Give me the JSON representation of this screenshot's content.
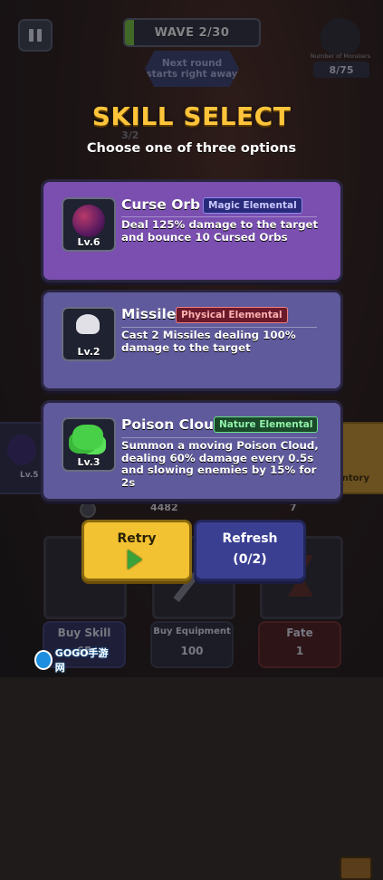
{
  "hud": {
    "wave_text": "WAVE 2/30",
    "wave_progress": 0.07,
    "next_round_text": "Next round starts right away",
    "monsters_label": "Number of Monsters",
    "monsters_count": "8/75",
    "bg_counter": "3/2"
  },
  "dialog": {
    "title": "SKILL SELECT",
    "subtitle": "Choose one of three options"
  },
  "skills": [
    {
      "name": "Curse Orb",
      "tag": "Magic Elemental",
      "level": "Lv.6",
      "description": "Deal 125% damage to the target and bounce 10 Cursed Orbs",
      "icon": "curse-orb-icon",
      "card_color": "#7a4fb0",
      "tag_color": "#5a5ae0"
    },
    {
      "name": "Missile",
      "tag": "Physical Elemental",
      "level": "Lv.2",
      "description": "Cast 2 Missiles dealing 100% damage to the target",
      "icon": "missile-icon",
      "card_color": "#5f5a9c",
      "tag_color": "#e05050"
    },
    {
      "name": "Poison Cloud",
      "tag": "Nature Elemental",
      "level": "Lv.3",
      "description": "Summon a moving Poison Cloud, dealing 60% damage every 0.5s and slowing enemies by 15% for 2s",
      "icon": "poison-cloud-icon",
      "card_color": "#5f5a9c",
      "tag_color": "#3aa860"
    }
  ],
  "side": {
    "left_level": "Lv.5",
    "right_label": "entory"
  },
  "bottom": {
    "coin_value": "4482",
    "gem_value": "7",
    "retry_label": "Retry",
    "refresh_label": "Refresh",
    "refresh_count": "(0/2)",
    "buy_skill_label": "Buy Skill",
    "buy_skill_cost": "65",
    "buy_equipment_label": "Buy Equipment",
    "buy_equipment_cost": "100",
    "fate_label": "Fate",
    "fate_cost": "1"
  },
  "watermark": "GOGO手游网"
}
